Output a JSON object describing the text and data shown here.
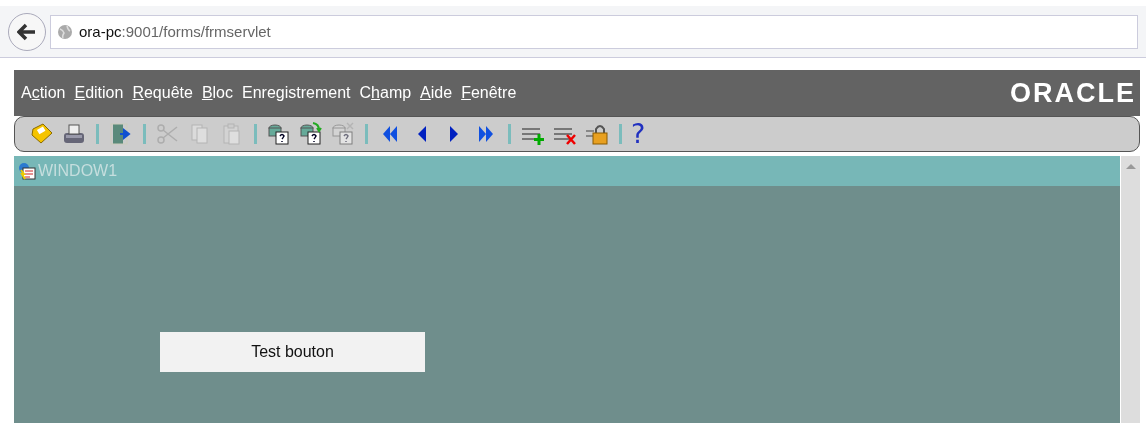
{
  "browser": {
    "url_host": "ora-pc",
    "url_path": ":9001/forms/frmservlet"
  },
  "menu": [
    {
      "pre": "A",
      "key": "c",
      "post": "tion"
    },
    {
      "key": "E",
      "post": "dition"
    },
    {
      "key": "R",
      "post": "equête"
    },
    {
      "key": "B",
      "post": "loc"
    },
    {
      "pre": "Enregistrement"
    },
    {
      "pre": "C",
      "key": "h",
      "post": "amp"
    },
    {
      "key": "A",
      "post": "ide"
    },
    {
      "key": "F",
      "post": "enêtre"
    }
  ],
  "logo": "ORACLE",
  "toolbar": [
    {
      "kind": "save",
      "disabled": false
    },
    {
      "kind": "print",
      "disabled": false
    },
    {
      "kind": "sep"
    },
    {
      "kind": "exit",
      "disabled": false
    },
    {
      "kind": "sep"
    },
    {
      "kind": "cut",
      "disabled": true
    },
    {
      "kind": "copy",
      "disabled": true
    },
    {
      "kind": "paste",
      "disabled": true
    },
    {
      "kind": "sep"
    },
    {
      "kind": "query",
      "disabled": false
    },
    {
      "kind": "execute",
      "disabled": false
    },
    {
      "kind": "cancel-query",
      "disabled": true
    },
    {
      "kind": "sep"
    },
    {
      "kind": "first",
      "disabled": false
    },
    {
      "kind": "prev",
      "disabled": false
    },
    {
      "kind": "next",
      "disabled": false
    },
    {
      "kind": "last",
      "disabled": false
    },
    {
      "kind": "sep"
    },
    {
      "kind": "insert",
      "disabled": false
    },
    {
      "kind": "delete",
      "disabled": false
    },
    {
      "kind": "lock",
      "disabled": false
    },
    {
      "kind": "sep"
    },
    {
      "kind": "help",
      "text": "?",
      "disabled": false
    }
  ],
  "window": {
    "title": "WINDOW1",
    "button": "Test bouton"
  }
}
